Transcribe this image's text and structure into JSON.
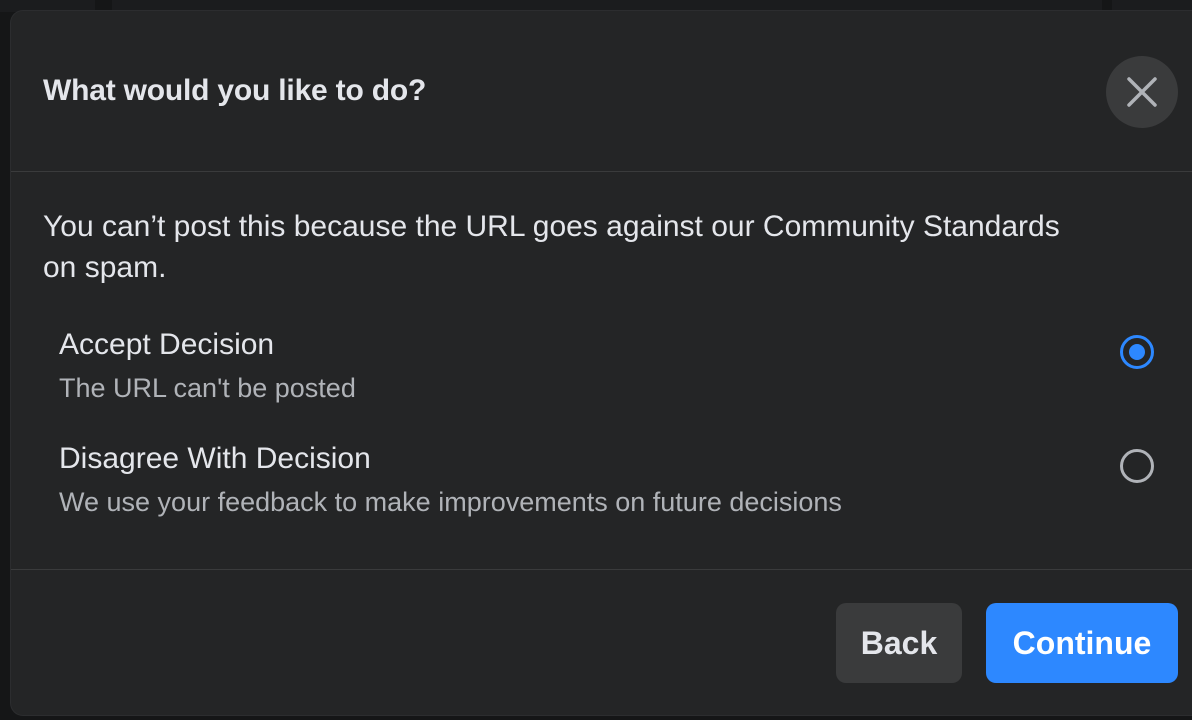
{
  "dialog": {
    "title": "What would you like to do?",
    "message": "You can’t post this because the URL goes against our Community Standards on spam.",
    "options": [
      {
        "label": "Accept Decision",
        "description": "The URL can't be posted",
        "selected": true
      },
      {
        "label": "Disagree With Decision",
        "description": "We use your feedback to make improvements on future decisions",
        "selected": false
      }
    ],
    "buttons": {
      "back_label": "Back",
      "continue_label": "Continue"
    }
  },
  "icons": {
    "close": "close-icon"
  },
  "colors": {
    "accent": "#2d88ff",
    "dialog_bg": "#242526",
    "secondary_button_bg": "#3a3b3c",
    "primary_text": "#e4e6eb",
    "secondary_text": "#b0b3b8"
  }
}
